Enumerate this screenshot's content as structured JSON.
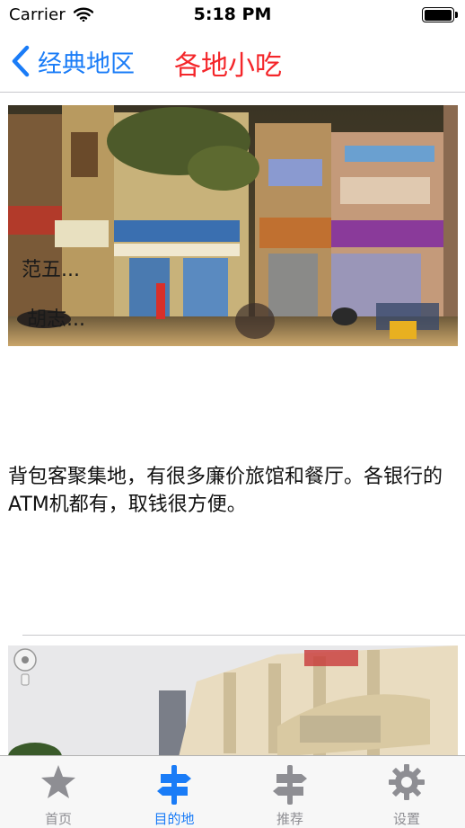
{
  "status_bar": {
    "carrier": "Carrier",
    "time": "5:18 PM"
  },
  "nav": {
    "back_label": "经典地区",
    "title": "各地小吃"
  },
  "content": {
    "photo_overlay_1": "范五...",
    "photo_overlay_2": "胡志...",
    "description": "背包客聚集地，有很多廉价旅馆和餐厅。各银行的ATM机都有，取钱很方便。"
  },
  "tabs": [
    {
      "label": "首页",
      "icon": "star-icon",
      "active": false
    },
    {
      "label": "目的地",
      "icon": "signpost-icon",
      "active": true
    },
    {
      "label": "推荐",
      "icon": "signpost-icon",
      "active": false
    },
    {
      "label": "设置",
      "icon": "gear-icon",
      "active": false
    }
  ],
  "colors": {
    "accent": "#1a7cf7",
    "title": "#f4262a",
    "inactive": "#8e8e93"
  }
}
